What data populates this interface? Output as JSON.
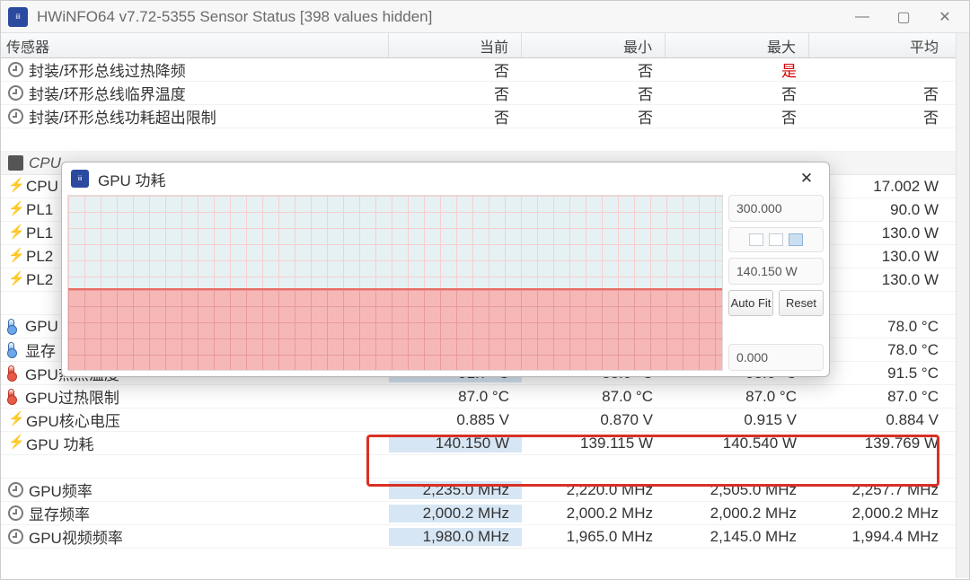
{
  "window": {
    "title": "HWiNFO64 v7.72-5355 Sensor Status [398 values hidden]"
  },
  "columns": {
    "sensor": "传感器",
    "current": "当前",
    "min": "最小",
    "max": "最大",
    "avg": "平均"
  },
  "rows": {
    "therm_throttle": {
      "label": "封装/环形总线过热降频",
      "cur": "否",
      "min": "否",
      "max": "是",
      "avg": ""
    },
    "crit_temp": {
      "label": "封装/环形总线临界温度",
      "cur": "否",
      "min": "否",
      "max": "否",
      "avg": "否"
    },
    "power_exceeded": {
      "label": "封装/环形总线功耗超出限制",
      "cur": "否",
      "min": "否",
      "max": "否",
      "avg": "否"
    },
    "cpu_section": {
      "label": "CPU"
    },
    "cpu": {
      "label": "CPU",
      "avg": "17.002 W"
    },
    "pl11": {
      "label": "PL1",
      "avg": "90.0 W"
    },
    "pl12": {
      "label": "PL1",
      "avg": "130.0 W"
    },
    "pl21": {
      "label": "PL2",
      "avg": "130.0 W"
    },
    "pl22": {
      "label": "PL2",
      "avg": "130.0 W"
    },
    "gpu_temp": {
      "label": "GPU",
      "avg": "78.0 °C"
    },
    "mem_temp": {
      "label": "显存",
      "avg": "78.0 °C"
    },
    "gpu_hotspot": {
      "label": "GPU热点温度",
      "cur": "91.7 °C",
      "min": "88.0 °C",
      "max": "93.6 °C",
      "avg": "91.5 °C"
    },
    "gpu_throttle": {
      "label": "GPU过热限制",
      "cur": "87.0 °C",
      "min": "87.0 °C",
      "max": "87.0 °C",
      "avg": "87.0 °C"
    },
    "gpu_core_v": {
      "label": "GPU核心电压",
      "cur": "0.885 V",
      "min": "0.870 V",
      "max": "0.915 V",
      "avg": "0.884 V"
    },
    "gpu_power": {
      "label": "GPU 功耗",
      "cur": "140.150 W",
      "min": "139.115 W",
      "max": "140.540 W",
      "avg": "139.769 W"
    },
    "gpu_freq": {
      "label": "GPU频率",
      "cur": "2,235.0 MHz",
      "min": "2,220.0 MHz",
      "max": "2,505.0 MHz",
      "avg": "2,257.7 MHz"
    },
    "mem_freq": {
      "label": "显存频率",
      "cur": "2,000.2 MHz",
      "min": "2,000.2 MHz",
      "max": "2,000.2 MHz",
      "avg": "2,000.2 MHz"
    },
    "gpu_vid": {
      "label": "GPU视频频率",
      "cur": "1,980.0 MHz",
      "min": "1,965.0 MHz",
      "max": "2,145.0 MHz",
      "avg": "1,994.4 MHz"
    }
  },
  "popup": {
    "title": "GPU 功耗",
    "y_max": "300.000",
    "y_cur": "140.150 W",
    "y_min": "0.000",
    "btn_autofit": "Auto Fit",
    "btn_reset": "Reset"
  },
  "chart_data": {
    "type": "area",
    "title": "GPU 功耗",
    "ylabel": "W",
    "ylim": [
      0,
      300
    ],
    "current": 140.15,
    "series": [
      {
        "name": "GPU 功耗",
        "values": [
          140.2,
          140.1,
          140.2,
          140.1,
          140.3,
          140.0,
          140.2,
          140.1,
          140.2,
          140.1,
          140.2,
          140.1,
          140.2,
          140.1,
          140.2,
          140.1,
          140.2,
          140.1,
          140.2,
          140.15
        ]
      }
    ]
  }
}
